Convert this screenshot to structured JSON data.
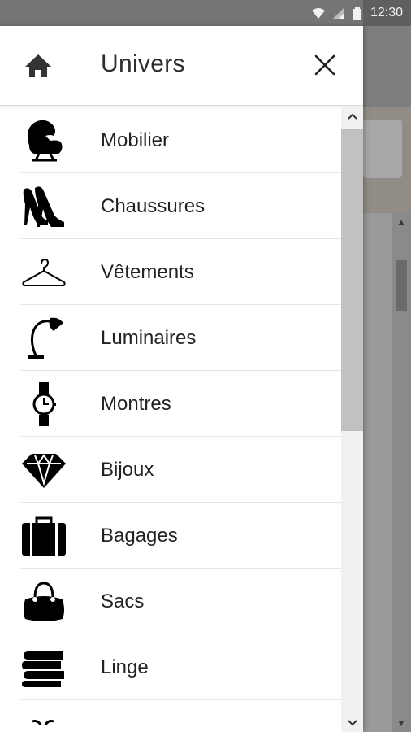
{
  "status_bar": {
    "time": "12:30",
    "icons": [
      "wifi-icon",
      "signal-icon",
      "battery-icon"
    ]
  },
  "drawer": {
    "title": "Univers",
    "home_icon": "home-icon",
    "close_icon": "close-icon",
    "items": [
      {
        "label": "Mobilier",
        "icon": "armchair-icon"
      },
      {
        "label": "Chaussures",
        "icon": "high-heels-icon"
      },
      {
        "label": "Vêtements",
        "icon": "hanger-icon"
      },
      {
        "label": "Luminaires",
        "icon": "desk-lamp-icon"
      },
      {
        "label": "Montres",
        "icon": "watch-icon"
      },
      {
        "label": "Bijoux",
        "icon": "diamond-icon"
      },
      {
        "label": "Bagages",
        "icon": "suitcase-icon"
      },
      {
        "label": "Sacs",
        "icon": "handbag-icon"
      },
      {
        "label": "Linge",
        "icon": "folded-linen-icon"
      }
    ]
  },
  "colors": {
    "drawer_bg": "#ffffff",
    "text": "#222222",
    "status_bar": "#757575",
    "scroll_thumb": "#c1c1c1"
  }
}
